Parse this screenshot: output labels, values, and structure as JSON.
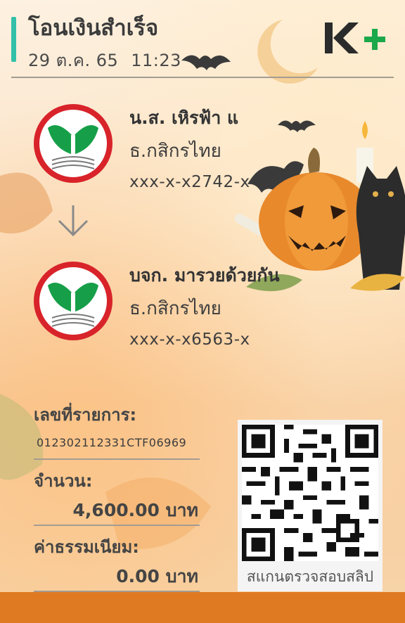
{
  "header": {
    "title": "โอนเงินสำเร็จ",
    "date": "29 ต.ค. 65",
    "time": "11:23",
    "logo_text": "K+",
    "accent_color": "#33c0a9",
    "logo_color": "#1ba84a"
  },
  "sender": {
    "name": "น.ส. เหิรฟ้า แ",
    "bank": "ธ.กสิกรไทย",
    "account": "xxx-x-x2742-x",
    "bank_icon": "kbank-logo-icon"
  },
  "receiver": {
    "name": "บจก. มารวยด้วยกัน",
    "bank": "ธ.กสิกรไทย",
    "account": "xxx-x-x6563-x",
    "bank_icon": "kbank-logo-icon"
  },
  "details": {
    "ref_label": "เลขที่รายการ:",
    "ref_value": "012302112331CTF06969",
    "amount_label": "จำนวน:",
    "amount_value": "4,600.00 บาท",
    "fee_label": "ค่าธรรมเนียม:",
    "fee_value": "0.00 บาท"
  },
  "qr": {
    "label": "สแกนตรวจสอบสลิป",
    "icon": "qr-code-icon"
  },
  "theme": {
    "footer_color": "#e07a22",
    "kbank_green": "#169f48",
    "kbank_red": "#d8232a"
  }
}
